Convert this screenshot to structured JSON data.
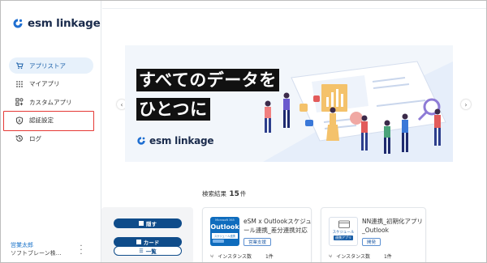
{
  "app": {
    "name": "esm linkage"
  },
  "sidebar": {
    "items": [
      {
        "label": "アプリストア",
        "icon": "cart-icon",
        "active": true
      },
      {
        "label": "マイアプリ",
        "icon": "grid-icon",
        "active": false
      },
      {
        "label": "カスタムアプリ",
        "icon": "custom-apps-icon",
        "active": false
      },
      {
        "label": "認証設定",
        "icon": "shield-icon",
        "active": false
      },
      {
        "label": "ログ",
        "icon": "history-icon",
        "active": false
      }
    ],
    "user": {
      "name": "営業太郎",
      "org": "ソフトブレーン株…"
    }
  },
  "banner": {
    "line1": "すべてのデータを",
    "line2": "ひとつに",
    "logo_text": "esm linkage"
  },
  "results": {
    "prefix": "検索結果",
    "count": "15",
    "suffix": "件"
  },
  "filter": {
    "hide_label": "隠す",
    "card_label": "カード",
    "list_label": "一覧"
  },
  "cards": [
    {
      "title_line1": "eSM x Outlookスケジュ",
      "title_line2": "ール連携_差分連携対応",
      "tag": "営業支援",
      "meta_label": "インスタンス数",
      "meta_value": "1件",
      "thumb_text": "Outlook",
      "thumb_sub": "スケジュール連携"
    },
    {
      "title_line1": "NN連携_初期化アプリ",
      "title_line2": "_Outlook",
      "tag": "開発",
      "meta_label": "インスタンス数",
      "meta_value": "1件",
      "thumb_text": "スケジュール",
      "thumb_sub": "連携アプリ"
    }
  ],
  "colors": {
    "accent": "#0f4c8a",
    "active_bg": "#e7f1fb",
    "highlight": "#e53935",
    "logo_blue": "#1f6fd1"
  }
}
